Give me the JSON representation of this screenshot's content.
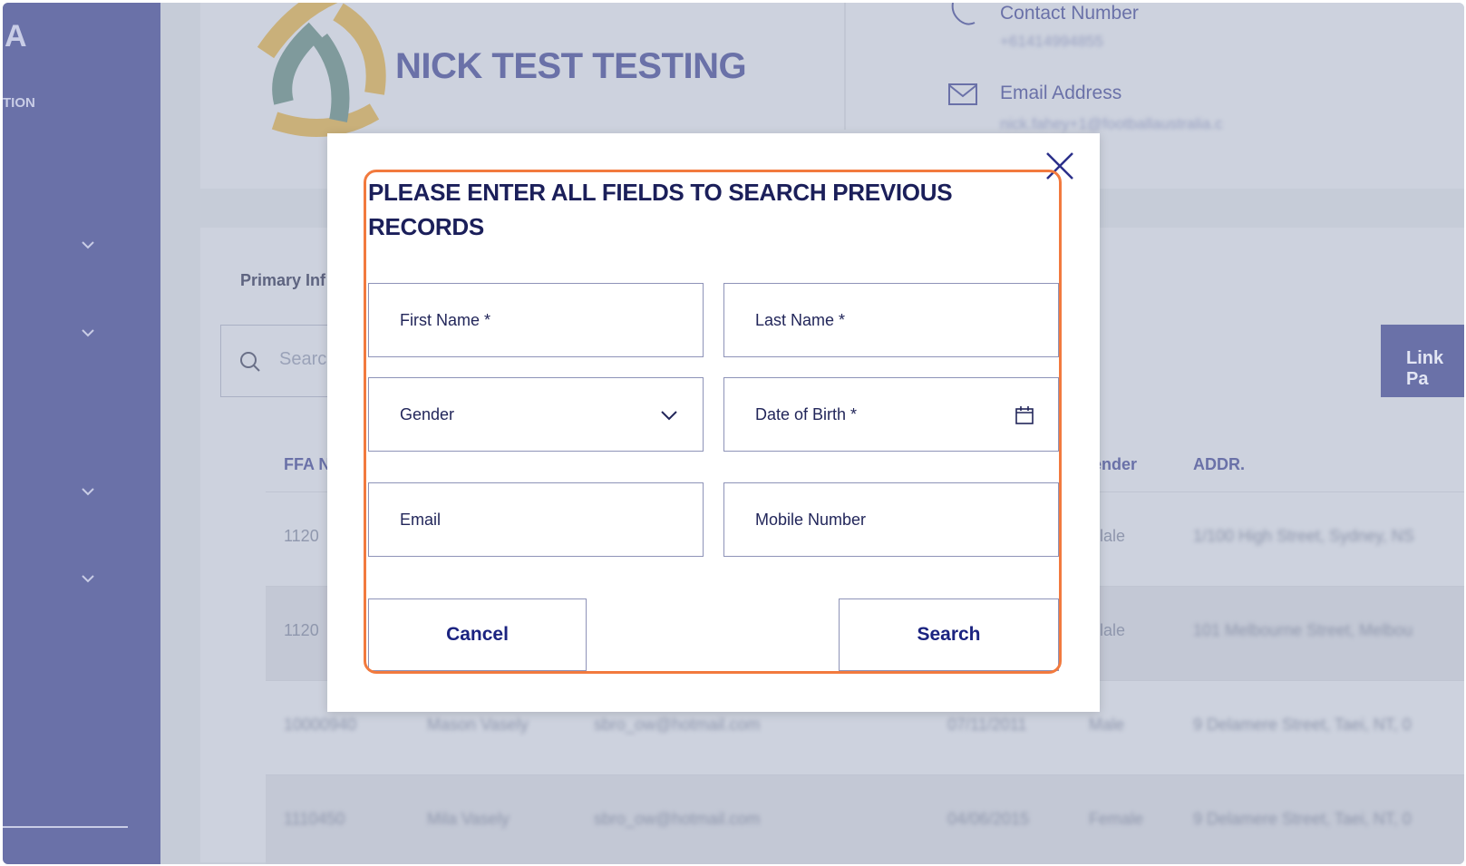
{
  "colors": {
    "accent": "#6a71a8",
    "highlight": "#f27a3e",
    "title": "#1b1f5a",
    "button_text": "#1b2380"
  },
  "sidebar": {
    "logo": "A",
    "subtitle": "TION"
  },
  "header": {
    "club_name": "NICK TEST TESTING",
    "contact_label": "Contact Number",
    "contact_value": "+61414994855",
    "email_label": "Email Address",
    "email_value": "nick.fahey+1@footballaustralia.c"
  },
  "content": {
    "tab": "Primary Inf",
    "search_placeholder": "Searc",
    "link_button": "Link Pa",
    "columns": [
      "FFA N",
      "ender",
      "ADDR."
    ],
    "rows": [
      [
        "1120",
        "lale",
        "1/100 High Street, Sydney, NS"
      ],
      [
        "1120",
        "lale",
        "101 Melbourne Street, Melbou"
      ],
      [
        "10000940",
        "Mason Vasely",
        "sbro_ow@hotmail.com",
        "07/11/2011",
        "Male",
        "9 Delamere Street, Taei, NT, 0"
      ],
      [
        "1110450",
        "Mila Vasely",
        "sbro_ow@hotmail.com",
        "04/06/2015",
        "Female",
        "9 Delamere Street, Taei, NT, 0"
      ]
    ]
  },
  "modal": {
    "title": "PLEASE ENTER ALL FIELDS TO SEARCH PREVIOUS RECORDS",
    "first_name": "First Name *",
    "last_name": "Last Name *",
    "gender": "Gender",
    "dob": "Date of Birth *",
    "email": "Email",
    "mobile": "Mobile Number",
    "cancel": "Cancel",
    "search": "Search"
  }
}
